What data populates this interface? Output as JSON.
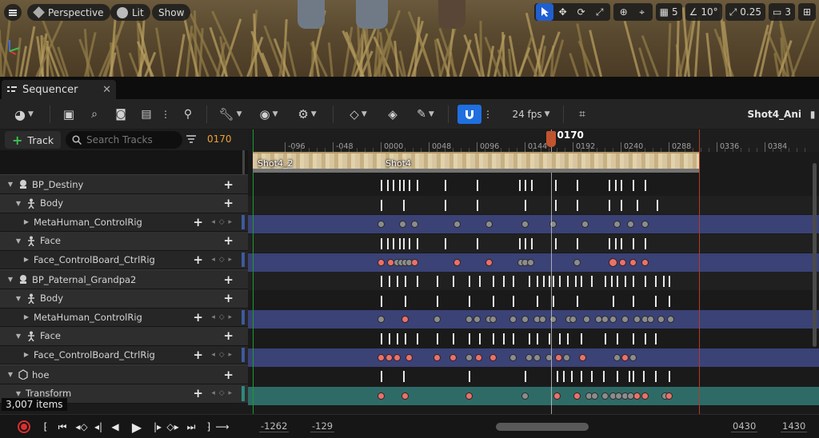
{
  "viewport": {
    "menu_icon": "hamburger-icon",
    "perspective_label": "Perspective",
    "lit_label": "Lit",
    "show_label": "Show",
    "grid_size": "5",
    "rotation_snap": "10°",
    "scale_snap": "0.25",
    "camera_speed": "3"
  },
  "tab": {
    "label": "Sequencer",
    "close": "✕"
  },
  "toolbar": {
    "fps_label": "24 fps",
    "shot_name": "Shot4_Ani"
  },
  "tracks_panel": {
    "add_track_label": "Track",
    "search_placeholder": "Search Tracks",
    "current_frame": "0170",
    "items_count": "3,007 items",
    "rows": [
      {
        "label": "BP_Destiny",
        "level": 0,
        "icon": "actor-icon"
      },
      {
        "label": "Body",
        "level": 1,
        "icon": "skeleton-icon"
      },
      {
        "label": "MetaHuman_ControlRig",
        "level": 2,
        "icon": "none"
      },
      {
        "label": "Face",
        "level": 1,
        "icon": "skeleton-icon"
      },
      {
        "label": "Face_ControlBoard_CtrlRig",
        "level": 2,
        "icon": "none"
      },
      {
        "label": "BP_Paternal_Grandpa2",
        "level": 0,
        "icon": "actor-icon"
      },
      {
        "label": "Body",
        "level": 1,
        "icon": "skeleton-icon"
      },
      {
        "label": "MetaHuman_ControlRig",
        "level": 2,
        "icon": "none"
      },
      {
        "label": "Face",
        "level": 1,
        "icon": "skeleton-icon"
      },
      {
        "label": "Face_ControlBoard_CtrlRig",
        "level": 2,
        "icon": "none"
      },
      {
        "label": "hoe",
        "level": 0,
        "icon": "mesh-icon"
      },
      {
        "label": "Transform",
        "level": 1,
        "icon": "none"
      }
    ]
  },
  "ruler": {
    "labels": [
      "4",
      "-096",
      "-048",
      "0000",
      "0048",
      "0096",
      "0144",
      "0192",
      "0240",
      "0288",
      "0336",
      "0384"
    ],
    "playhead_label": "0170"
  },
  "shots": [
    {
      "label": "Shot4_2"
    },
    {
      "label": "Shot4"
    }
  ],
  "transport": {
    "field_1": "-1262",
    "field_2": "-129",
    "field_3": "0430",
    "field_4": "1430"
  },
  "colors": {
    "accent_blue": "#1f6fe0",
    "playhead": "#c0542e",
    "frame_orange": "#f0a030",
    "band_blue": "#3a4276",
    "band_teal": "#2e6b67",
    "key_red": "#e8736a"
  }
}
